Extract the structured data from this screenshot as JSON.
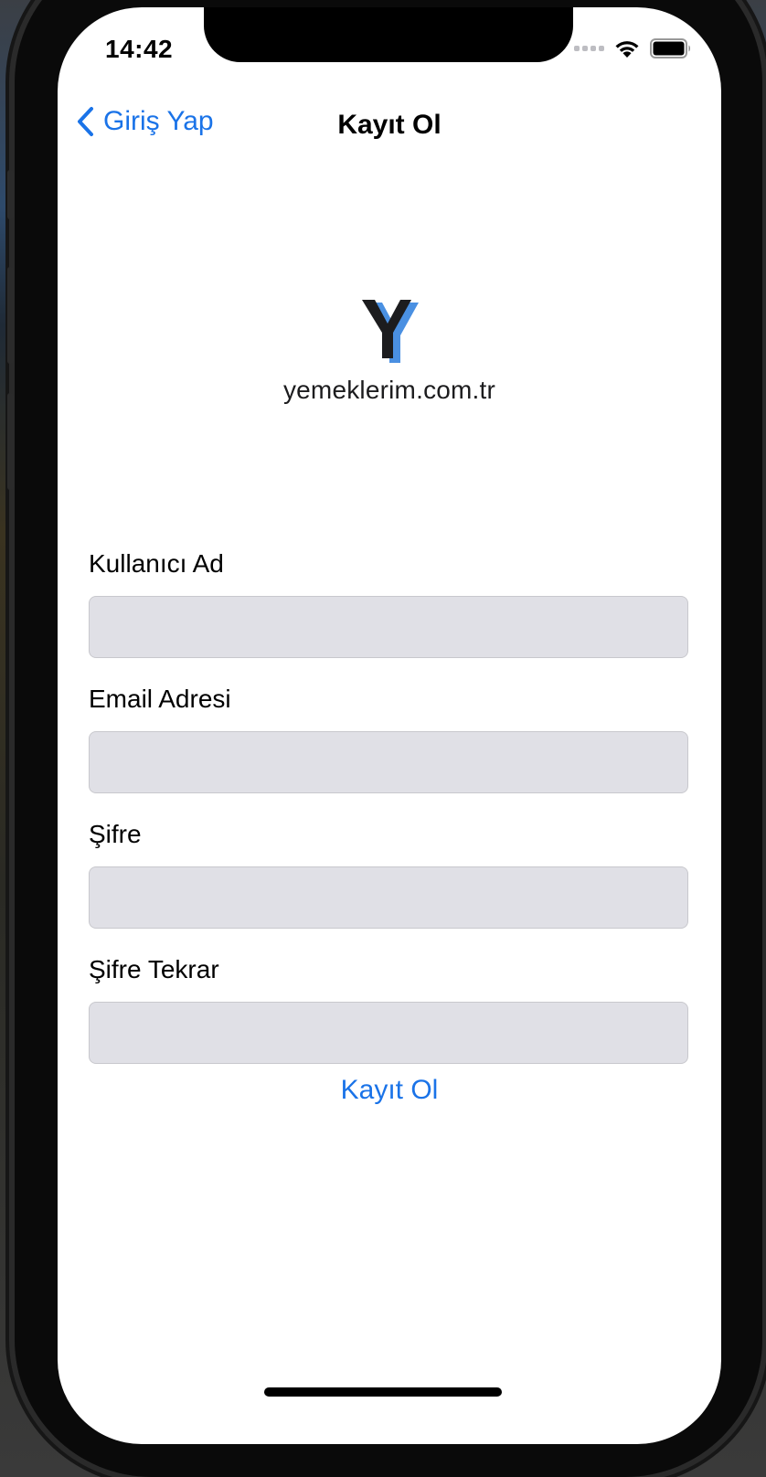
{
  "status_bar": {
    "time": "14:42",
    "icons": [
      "signal-icon",
      "wifi-icon",
      "battery-icon"
    ]
  },
  "nav": {
    "back_label": "Giriş Yap",
    "title": "Kayıt Ol"
  },
  "logo": {
    "mark": "Y",
    "text": "yemeklerim.com.tr",
    "accent_color": "#4a90e2"
  },
  "form": {
    "username_label": "Kullanıcı Ad",
    "username_value": "",
    "email_label": "Email Adresi",
    "email_value": "",
    "password_label": "Şifre",
    "password_value": "",
    "password_repeat_label": "Şifre Tekrar",
    "password_repeat_value": ""
  },
  "submit_label": "Kayıt Ol",
  "colors": {
    "accent": "#1a73e8",
    "input_background": "#e0e0e6"
  }
}
